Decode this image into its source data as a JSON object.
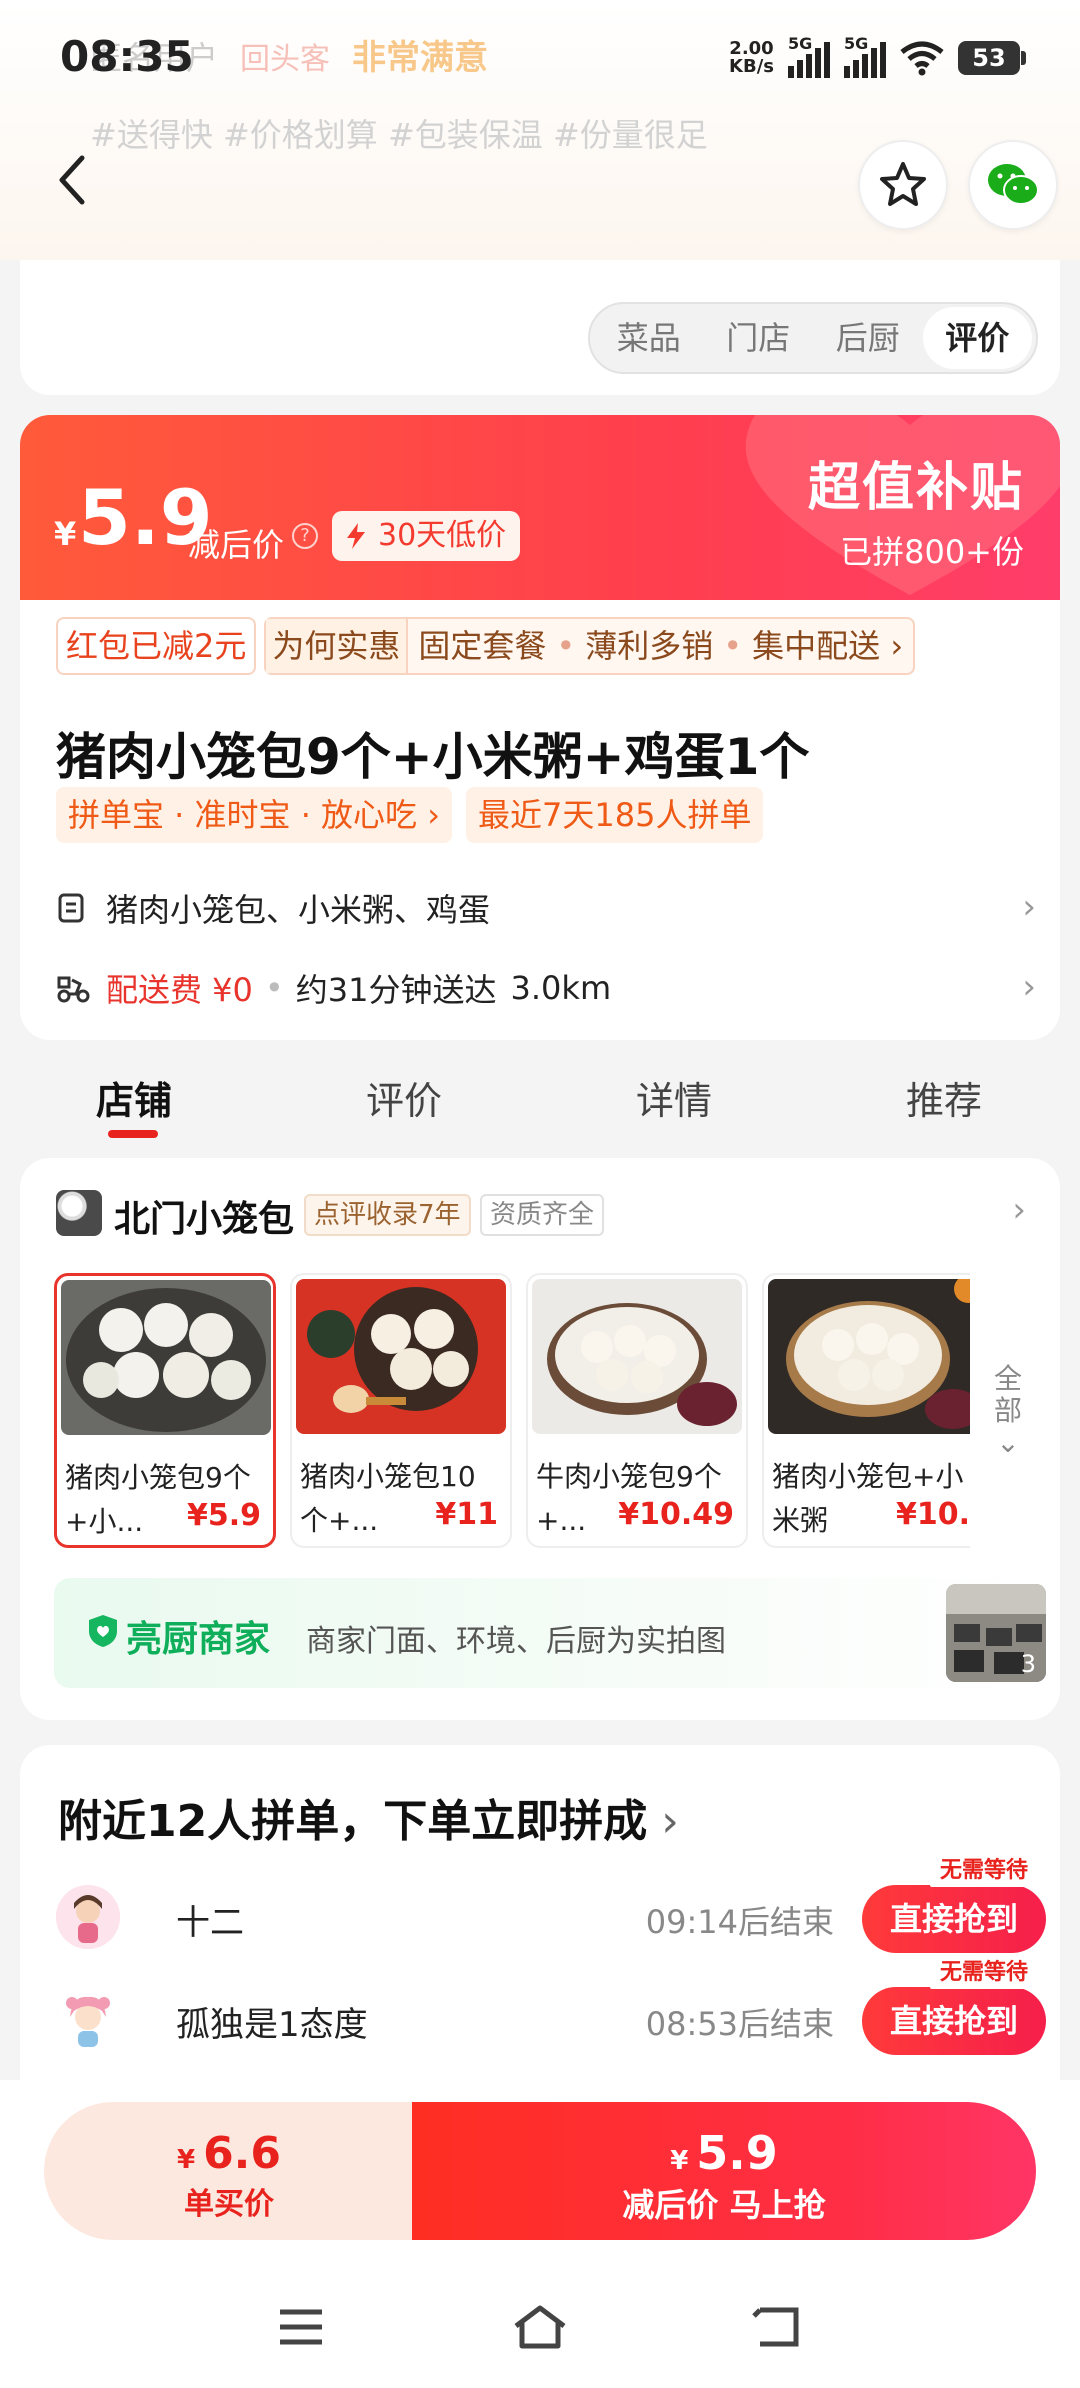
{
  "status_bar": {
    "time": "08:35",
    "net_speed_value": "2.00",
    "net_speed_unit": "KB/s",
    "sim1": "5G",
    "sim2": "5G",
    "battery": "53"
  },
  "background_review": {
    "user": "匿名用户",
    "tag_returning": "回头客",
    "tag_rating": "非常满意",
    "hashtags": "#送得快 #价格划算 #包装保温 #份量很足"
  },
  "header_tabs": [
    "菜品",
    "门店",
    "后厨",
    "评价"
  ],
  "header_active_tab": "评价",
  "price_banner": {
    "currency": "¥",
    "price": "5.9",
    "price_label": "减后价",
    "low_price_badge": "30天低价",
    "subsidy_title": "超值补贴",
    "subsidy_sub": "已拼800+份"
  },
  "promo_tags": {
    "red_packet": "红包已减2元",
    "why_cheap": "为何实惠",
    "reasons": [
      "固定套餐",
      "薄利多销",
      "集中配送"
    ]
  },
  "product": {
    "name": "猪肉小笼包9个+小米粥+鸡蛋1个",
    "guarantee_tag": "拼单宝 · 准时宝 · 放心吃",
    "recent_tag": "最近7天185人拼单",
    "contents": "猪肉小笼包、小米粥、鸡蛋",
    "delivery_fee": "配送费 ¥0",
    "delivery_time": "约31分钟送达",
    "distance": "3.0km"
  },
  "section_tabs": [
    "店铺",
    "评价",
    "详情",
    "推荐"
  ],
  "section_active_tab": "店铺",
  "store": {
    "name": "北门小笼包",
    "tag_years": "点评收录7年",
    "tag_license": "资质齐全",
    "dishes": [
      {
        "name": "猪肉小笼包9个+小...",
        "price": "¥5.9"
      },
      {
        "name": "猪肉小笼包10个+...",
        "price": "¥11"
      },
      {
        "name": "牛肉小笼包9个+...",
        "price": "¥10.49"
      },
      {
        "name": "猪肉小笼包+小米粥",
        "price": "¥10."
      }
    ],
    "all_label": "全部",
    "kitchen_title": "亮厨商家",
    "kitchen_desc": "商家门面、环境、后厨为实拍图",
    "kitchen_photo_count": "3"
  },
  "group_buy": {
    "title": "附近12人拼单，下单立即拼成",
    "rows": [
      {
        "user": "十二",
        "countdown": "09:14后结束",
        "button": "直接抢到",
        "badge": "无需等待"
      },
      {
        "user": "孤独是1态度",
        "countdown": "08:53后结束",
        "button": "直接抢到",
        "badge": "无需等待"
      }
    ]
  },
  "bottom_bar": {
    "single_currency": "¥",
    "single_price": "6.6",
    "single_label": "单买价",
    "group_currency": "¥",
    "group_price": "5.9",
    "group_label": "减后价 马上抢"
  },
  "colors": {
    "brand_red": "#e8231e",
    "kitchen_green": "#0fae5a",
    "tag_orange": "#ef5a17"
  }
}
